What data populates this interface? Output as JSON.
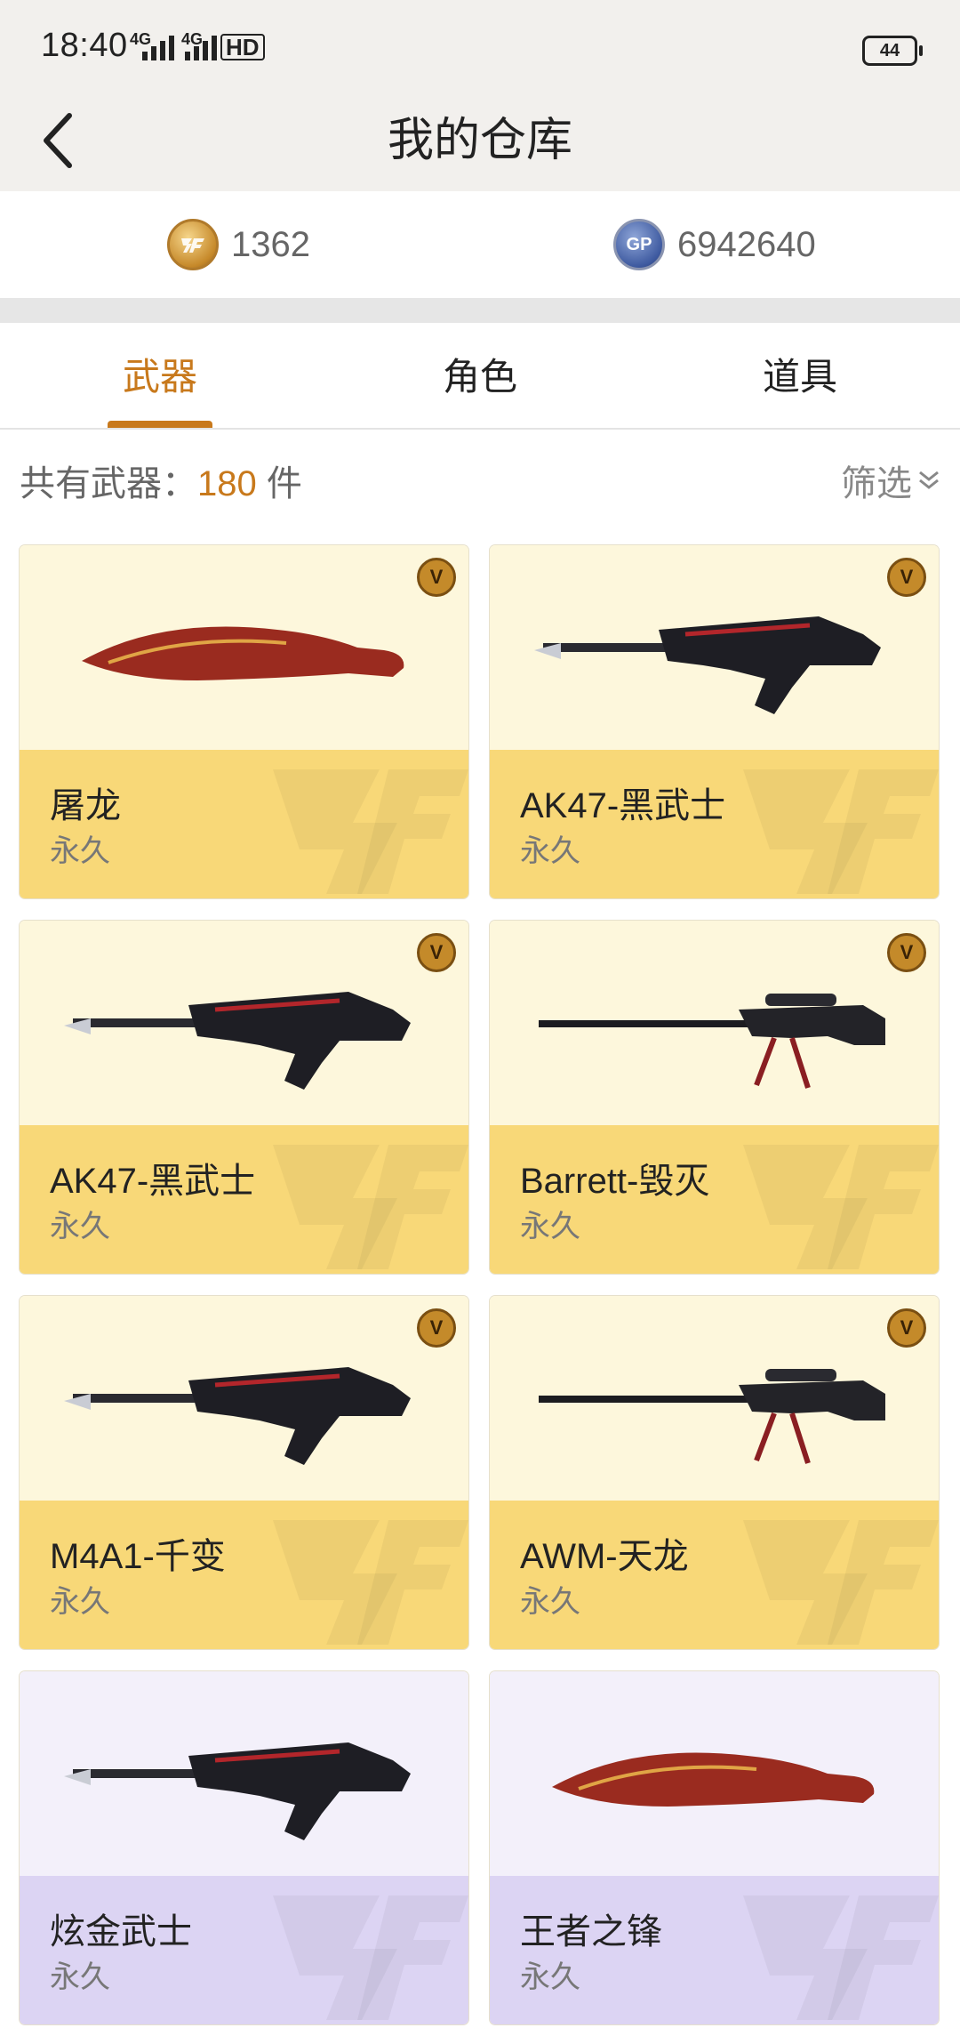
{
  "status_bar": {
    "time": "18:40",
    "network_1": "4G",
    "network_2": "4G",
    "hd": "HD",
    "battery": "44"
  },
  "header": {
    "title": "我的仓库"
  },
  "currency": {
    "cf_value": "1362",
    "cf_icon": "cf-coin-icon",
    "gp_value": "6942640",
    "gp_label": "GP"
  },
  "tabs": [
    {
      "label": "武器",
      "active": true
    },
    {
      "label": "角色",
      "active": false
    },
    {
      "label": "道具",
      "active": false
    }
  ],
  "list_header": {
    "count_label": "共有武器：",
    "count_value": "180",
    "count_unit": "件",
    "filter_label": "筛选"
  },
  "items": [
    {
      "name": "屠龙",
      "duration": "永久",
      "badge": "V",
      "theme": "gold",
      "icon": "knife-icon"
    },
    {
      "name": "AK47-黑武士",
      "duration": "永久",
      "badge": "V",
      "theme": "gold",
      "icon": "rifle-icon"
    },
    {
      "name": "AK47-黑武士",
      "duration": "永久",
      "badge": "V",
      "theme": "gold",
      "icon": "rifle-icon"
    },
    {
      "name": "Barrett-毁灭",
      "duration": "永久",
      "badge": "V",
      "theme": "gold",
      "icon": "sniper-icon"
    },
    {
      "name": "M4A1-千变",
      "duration": "永久",
      "badge": "V",
      "theme": "gold",
      "icon": "rifle-icon"
    },
    {
      "name": "AWM-天龙",
      "duration": "永久",
      "badge": "V",
      "theme": "gold",
      "icon": "sniper-icon"
    },
    {
      "name": "炫金武士",
      "duration": "永久",
      "badge": "",
      "theme": "purple",
      "icon": "rifle-icon"
    },
    {
      "name": "王者之锋",
      "duration": "永久",
      "badge": "",
      "theme": "purple",
      "icon": "knife-icon"
    }
  ],
  "colors": {
    "accent": "#c8791c",
    "gold_card": "#f8d878",
    "purple_card": "#dcd4f3"
  }
}
